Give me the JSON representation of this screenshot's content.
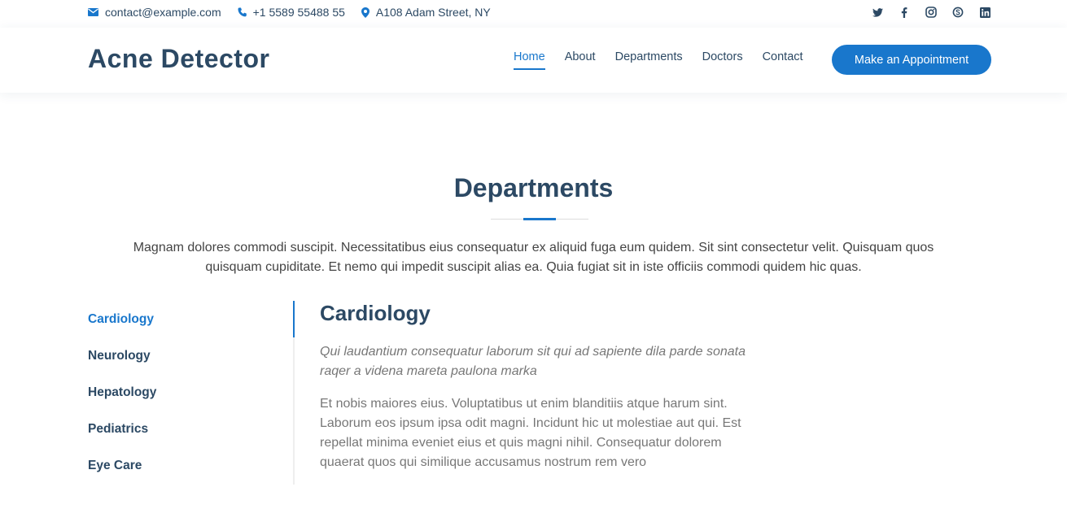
{
  "topbar": {
    "email": "contact@example.com",
    "phone": "+1 5589 55488 55",
    "address": "A108 Adam Street, NY",
    "social": [
      "twitter-icon",
      "facebook-icon",
      "instagram-icon",
      "skype-icon",
      "linkedin-icon"
    ]
  },
  "header": {
    "logo": "Acne Detector",
    "nav": [
      "Home",
      "About",
      "Departments",
      "Doctors",
      "Contact"
    ],
    "active_nav": "Home",
    "cta": "Make an Appointment"
  },
  "section": {
    "title": "Departments",
    "description": "Magnam dolores commodi suscipit. Necessitatibus eius consequatur ex aliquid fuga eum quidem. Sit sint consectetur velit. Quisquam quos quisquam cupiditate. Et nemo qui impedit suscipit alias ea. Quia fugiat sit in iste officiis commodi quidem hic quas."
  },
  "tabs": {
    "items": [
      "Cardiology",
      "Neurology",
      "Hepatology",
      "Pediatrics",
      "Eye Care"
    ],
    "active": "Cardiology"
  },
  "content": {
    "title": "Cardiology",
    "italic": "Qui laudantium consequatur laborum sit qui ad sapiente dila parde sonata raqer a videna mareta paulona marka",
    "body": "Et nobis maiores eius. Voluptatibus ut enim blanditiis atque harum sint. Laborum eos ipsum ipsa odit magni. Incidunt hic ut molestiae aut qui. Est repellat minima eveniet eius et quis magni nihil. Consequatur dolorem quaerat quos qui similique accusamus nostrum rem vero"
  },
  "colors": {
    "primary": "#1977cc",
    "heading": "#2c4964",
    "text": "#444444",
    "muted": "#777777"
  }
}
